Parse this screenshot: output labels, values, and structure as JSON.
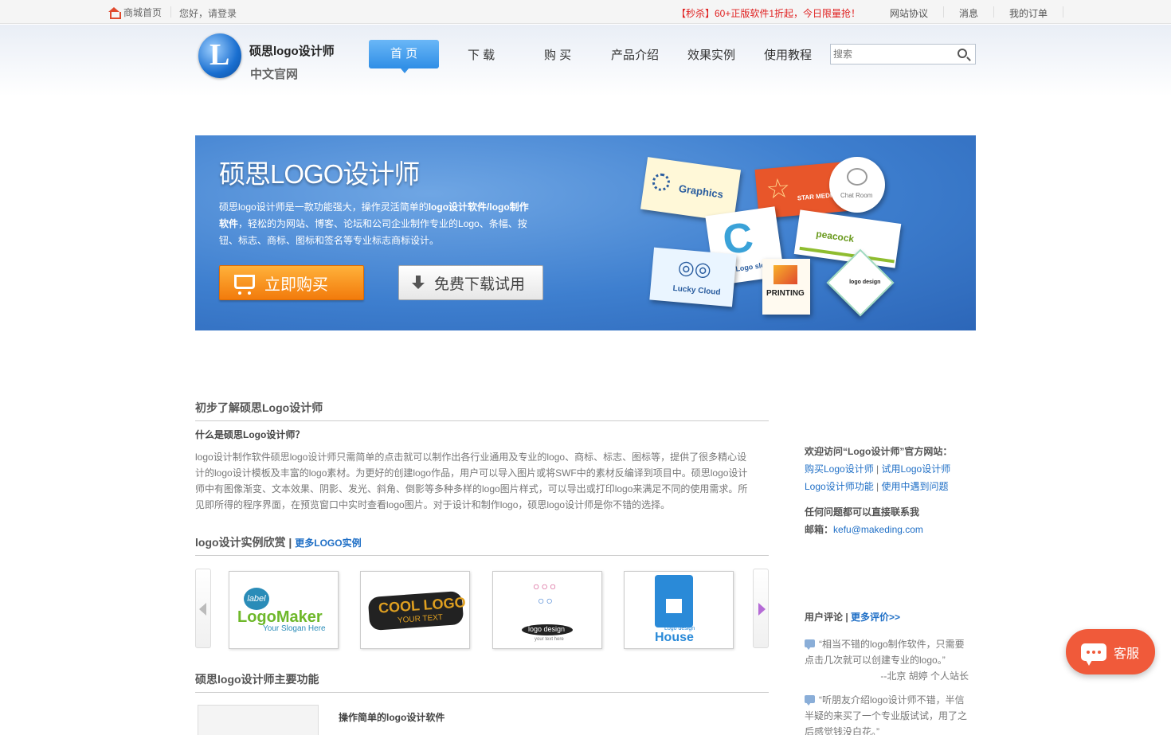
{
  "topbar": {
    "home": "商城首页",
    "greeting": "您好，请登录",
    "promo": "【秒杀】60+正版软件1折起，今日限量抢！",
    "links": [
      "网站协议",
      "消息",
      "我的订单"
    ]
  },
  "header": {
    "brand_line1": "硕思logo设计师",
    "brand_line2": "中文官网",
    "nav": [
      "首 页",
      "下 载",
      "购 买",
      "产品介绍",
      "效果实例",
      "使用教程"
    ],
    "search_placeholder": "搜索"
  },
  "banner": {
    "title": "硕思LOGO设计师",
    "desc_pre": "硕思logo设计师是一款功能强大，操作灵活简单的",
    "desc_bold": "logo设计软件/logo制作软件",
    "desc_post": "，轻松的为网站、博客、论坛和公司企业制作专业的Logo、条幅、按钮、标志、商标、图标和签名等专业标志商标设计。",
    "buy_label": "立即购买",
    "download_label": "免费下载试用",
    "cards": [
      "Graphics",
      "STAR MEDIA",
      "Chat Room",
      "Cool Logo slogan",
      "peacock",
      "Lucky Cloud",
      "PRINTING",
      "logo design"
    ]
  },
  "intro": {
    "section_title": "初步了解硕思Logo设计师",
    "question": "什么是硕思Logo设计师？",
    "body": "logo设计制作软件硕思logo设计师只需简单的点击就可以制作出各行业通用及专业的logo、商标、标志、图标等，提供了很多精心设计的logo设计模板及丰富的logo素材。为更好的创建logo作品，用户可以导入图片或将SWF中的素材反编译到项目中。硕思logo设计师中有图像渐变、文本效果、阴影、发光、斜角、倒影等多种多样的logo图片样式，可以导出或打印logo来满足不同的使用需求。所见即所得的程序界面，在预览窗口中实时查看logo图片。对于设计和制作logo，硕思logo设计师是你不错的选择。"
  },
  "gallery": {
    "title": "logo设计实例欣赏 | ",
    "more": "更多LOGO实例",
    "thumbs": [
      {
        "top": "label",
        "main": "LogoMaker",
        "sub": "Your Slogan Here"
      },
      {
        "top": "",
        "main": "COOL LOGO",
        "sub": "YOUR TEXT"
      },
      {
        "top": "",
        "main": "logo design",
        "sub": "your text here"
      },
      {
        "top": "",
        "main": "House",
        "sub": "Logo design"
      }
    ]
  },
  "features": {
    "title": "硕思logo设计师主要功能",
    "item1": "操作简单的logo设计软件"
  },
  "sidebar": {
    "welcome": "欢迎访问“Logo设计师”官方网站：",
    "link1": "购买Logo设计师",
    "link2": "试用Logo设计师",
    "link3": "Logo设计师功能",
    "link4": "使用中遇到问题",
    "divider": " | ",
    "question": "任何问题都可以直接联系我",
    "mail_label": "邮箱：",
    "mail": "kefu@makeding.com",
    "reviews_title": "用户评论 | ",
    "reviews_more": "更多评价>>",
    "quote1": "“相当不错的logo制作软件，只需要点击几次就可以创建专业的logo。”",
    "quote1_by": "--北京 胡婷 个人站长",
    "quote2": "“听朋友介绍logo设计师不错，半信半疑的来买了一个专业版试试，用了之后感觉钱没白花。”"
  },
  "service": {
    "label": "客服"
  }
}
